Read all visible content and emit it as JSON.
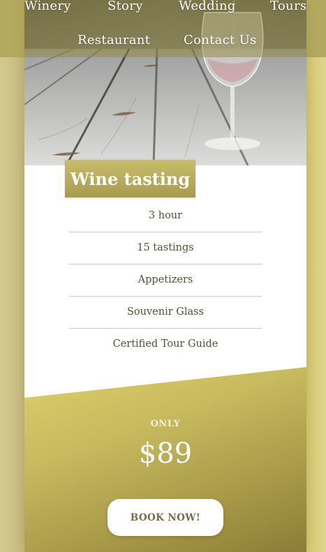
{
  "nav": {
    "items": [
      {
        "label": "Winery"
      },
      {
        "label": "Story"
      },
      {
        "label": "Wedding"
      },
      {
        "label": "Tours"
      },
      {
        "label": "Restaurant"
      },
      {
        "label": "Contact Us"
      }
    ]
  },
  "hero": {
    "image": "wine-glass-on-wooden-table-photo"
  },
  "tour": {
    "title": "Wine tasting",
    "features": [
      "3 hour",
      "15 tastings",
      "Appetizers",
      "Souvenir Glass",
      "Certified Tour Guide"
    ]
  },
  "pricing": {
    "only_label": "ONLY",
    "price": "$89",
    "book_label": "BOOK NOW!"
  },
  "colors": {
    "accent": "#c9bd6a",
    "panel_dark": "#8c7d37",
    "text": "#55503c",
    "button_text": "#7a6b4a"
  }
}
